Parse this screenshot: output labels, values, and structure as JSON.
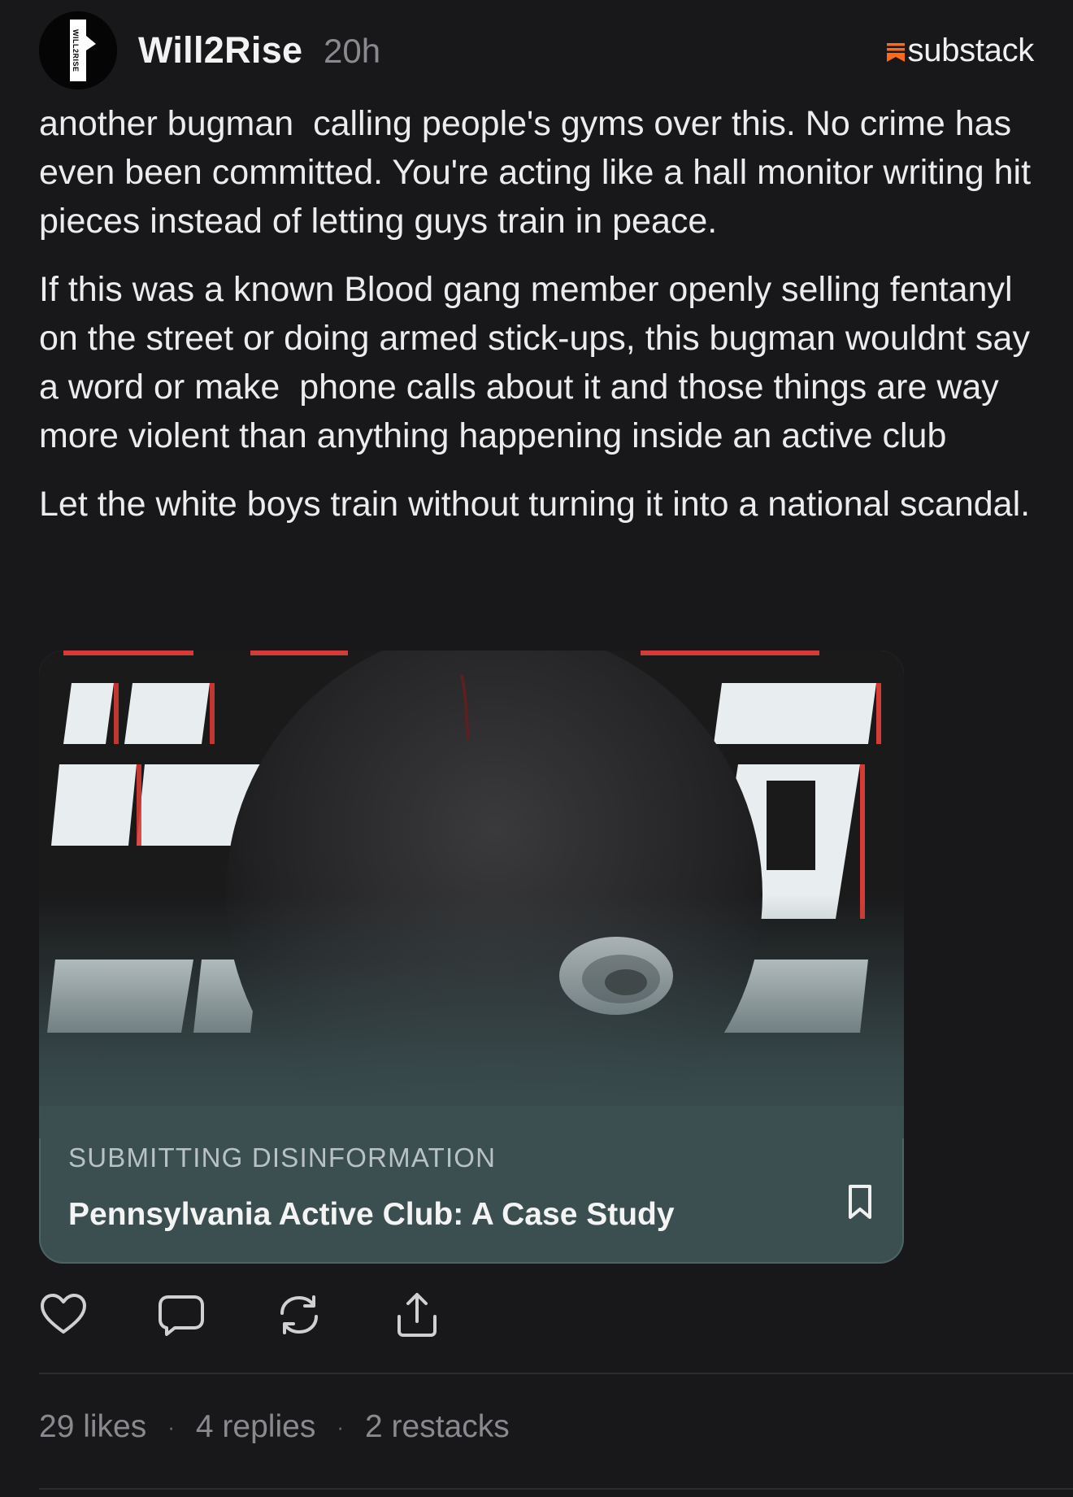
{
  "post": {
    "author": "Will2Rise",
    "time": "20h",
    "avatar_text": "WILL2RISE",
    "brand": "substack",
    "paragraphs": [
      "another bugman  calling people's gyms over this. No crime has even been committed. You're acting like a hall monitor writing hit pieces instead of letting guys train in peace.",
      "If this was a known Blood gang member openly selling fentanyl on the street or doing armed stick-ups, this bugman wouldnt say a word or make  phone calls about it and those things are way more violent than anything happening inside an active club",
      "Let the white boys train without turning it into a national scandal."
    ]
  },
  "card": {
    "publication": "SUBMITTING DISINFORMATION",
    "title": "Pennsylvania Active Club: A Case Study"
  },
  "actions": [
    "heart-icon",
    "comment-icon",
    "restack-icon",
    "share-icon"
  ],
  "stats": {
    "likes": "29 likes",
    "replies": "4 replies",
    "restacks": "2 restacks",
    "separator": "·"
  },
  "colors": {
    "background": "#18181b",
    "text": "#ececec",
    "muted": "#8a8a8e",
    "card": "#3b4e50",
    "brand_accent": "#ff6719"
  }
}
